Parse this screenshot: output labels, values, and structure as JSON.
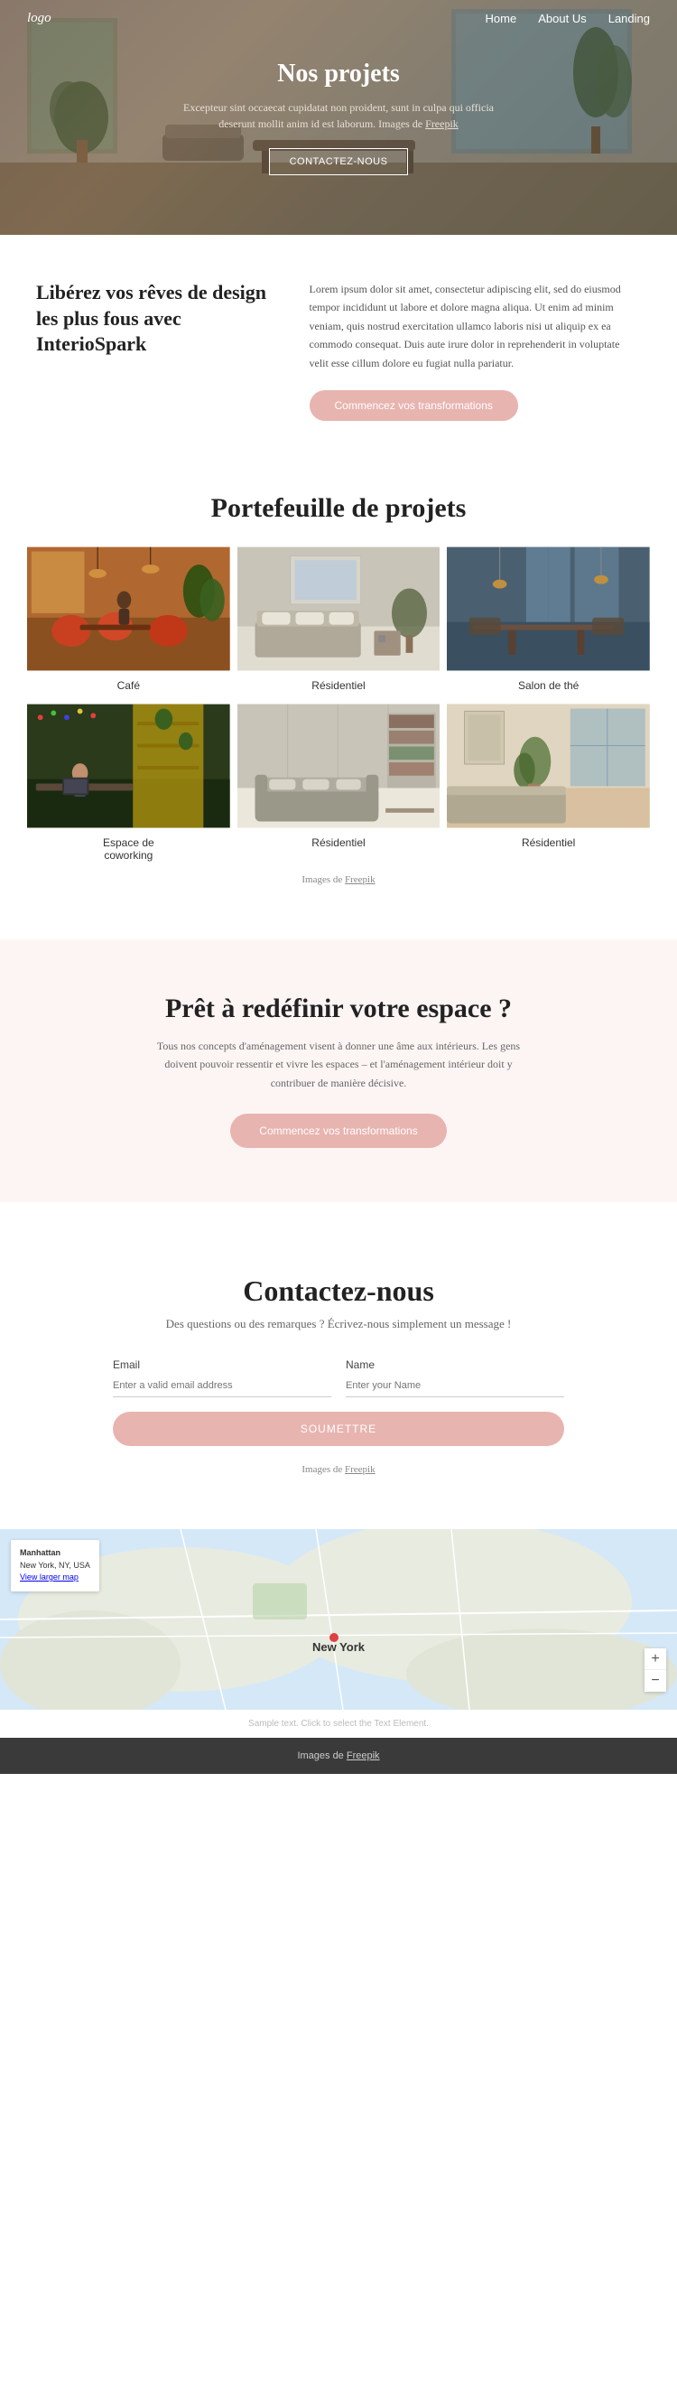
{
  "nav": {
    "logo": "logo",
    "links": [
      "Home",
      "About Us",
      "Landing"
    ]
  },
  "hero": {
    "title": "Nos projets",
    "description": "Excepteur sint occaecat cupidatat non proident, sunt in culpa qui officia deserunt mollit anim id est laborum. Images de Freepik",
    "freepik_link": "Freepik",
    "cta": "CONTACTEZ-NOUS"
  },
  "about": {
    "heading": "Libérez vos rêves de design les plus fous avec InterioSpark",
    "body": "Lorem ipsum dolor sit amet, consectetur adipiscing elit, sed do eiusmod tempor incididunt ut labore et dolore magna aliqua. Ut enim ad minim veniam, quis nostrud exercitation ullamco laboris nisi ut aliquip ex ea commodo consequat. Duis aute irure dolor in reprehenderit in voluptate velit esse cillum dolore eu fugiat nulla pariatur.",
    "cta": "Commencez vos transformations"
  },
  "portfolio": {
    "title": "Portefeuille de projets",
    "items": [
      {
        "label": "Café",
        "style": "cafe"
      },
      {
        "label": "Résidentiel",
        "style": "residential1"
      },
      {
        "label": "Salon de thé",
        "style": "salon"
      },
      {
        "label": "Espace de coworking",
        "style": "coworking"
      },
      {
        "label": "Résidentiel",
        "style": "residential2"
      },
      {
        "label": "Résidentiel",
        "style": "residential3"
      }
    ],
    "credit": "Images de Freepik"
  },
  "ready": {
    "title": "Prêt à redéfinir votre espace ?",
    "description": "Tous nos concepts d'aménagement visent à donner une âme aux intérieurs. Les gens doivent pouvoir ressentir et vivre les espaces – et l'aménagement intérieur doit y contribuer de manière décisive.",
    "cta": "Commencez vos transformations"
  },
  "contact": {
    "title": "Contactez-nous",
    "subtitle": "Des questions ou des remarques ? Écrivez-nous simplement un message !",
    "email_label": "Email",
    "email_placeholder": "Enter a valid email address",
    "name_label": "Name",
    "name_placeholder": "Enter your Name",
    "submit": "SOUMETTRE",
    "credit": "Images de Freepik"
  },
  "map": {
    "location": "Manhattan\nNew York, NY, USA",
    "view_larger": "View larger map",
    "city_label": "New York"
  },
  "footer": {
    "sample_text": "Sample text. Click to select the Text Element.",
    "credit": "Images de Freepik"
  }
}
